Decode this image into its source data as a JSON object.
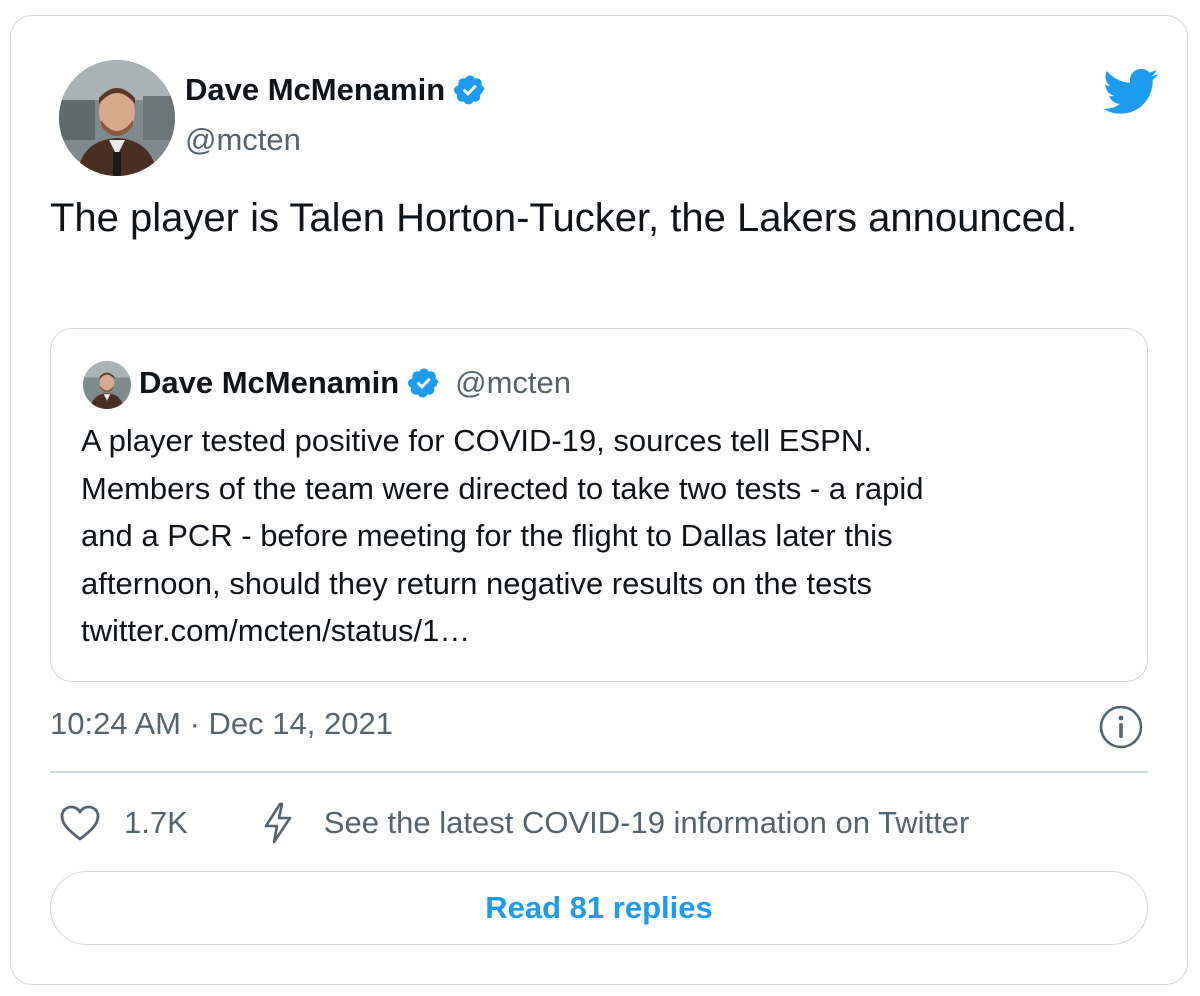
{
  "author": {
    "display_name": "Dave McMenamin",
    "handle": "@mcten",
    "verified": true
  },
  "tweet": {
    "text": "The player is Talen Horton-Tucker, the Lakers announced."
  },
  "quoted_tweet": {
    "display_name": "Dave McMenamin",
    "handle": "@mcten",
    "verified": true,
    "lines": [
      "A player tested positive for COVID-19, sources tell ESPN.",
      "Members of the team were directed to take two tests - a rapid",
      "and a PCR - before meeting for the flight to Dallas later this",
      "afternoon, should they return negative results on the tests",
      "twitter.com/mcten/status/1…"
    ]
  },
  "meta": {
    "timestamp": "10:24 AM · Dec 14, 2021"
  },
  "actions": {
    "like_count": "1.7K",
    "covid_link": "See the latest COVID-19 information on Twitter"
  },
  "footer": {
    "read_replies_label": "Read 81 replies"
  },
  "icons": {
    "brand": "twitter-bird-icon",
    "verified": "verified-badge-icon",
    "info": "info-icon",
    "like": "heart-icon",
    "covid": "lightning-icon"
  },
  "colors": {
    "brand_blue": "#1d9bf0",
    "text_primary": "#0f1419",
    "text_secondary": "#536471",
    "border": "#cfd9de"
  }
}
